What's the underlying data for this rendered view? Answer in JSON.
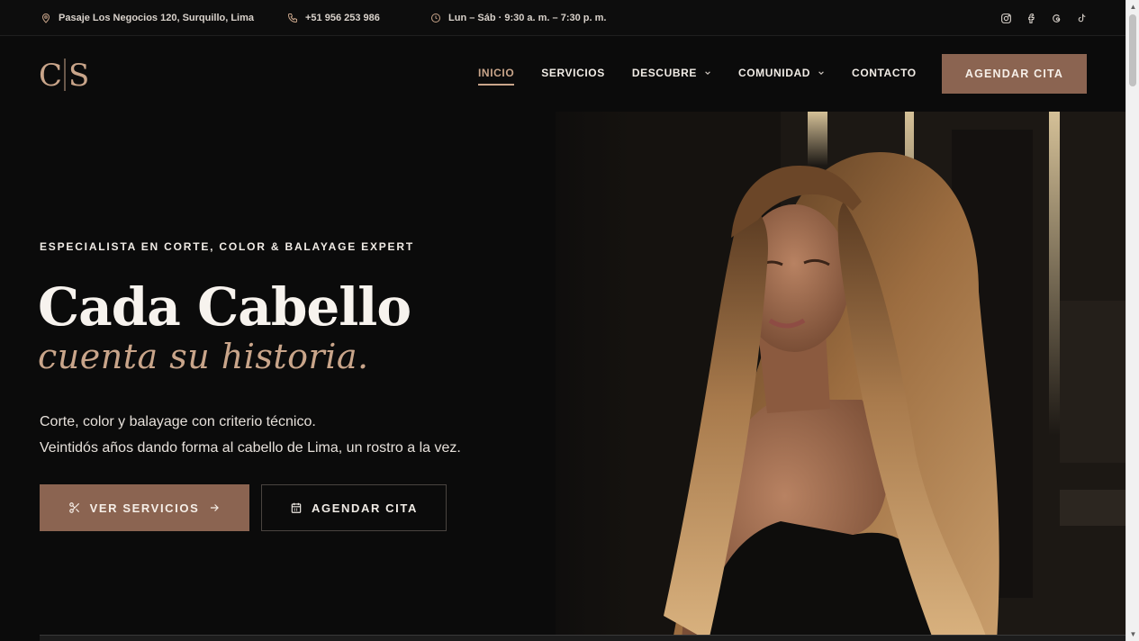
{
  "topbar": {
    "address": "Pasaje Los Negocios 120, Surquillo, Lima",
    "phone": "+51 956 253 986",
    "hours": "Lun – Sáb · 9:30 a. m. – 7:30 p. m.",
    "social_icons": [
      "instagram-icon",
      "facebook-icon",
      "threads-icon",
      "tiktok-icon"
    ]
  },
  "header": {
    "logo_text": "CS",
    "nav": [
      {
        "label": "INICIO",
        "active": true
      },
      {
        "label": "SERVICIOS"
      },
      {
        "label": "DESCUBRE",
        "dropdown": true
      },
      {
        "label": "COMUNIDAD",
        "dropdown": true
      },
      {
        "label": "CONTACTO"
      }
    ],
    "cta_label": "AGENDAR CITA"
  },
  "hero": {
    "kicker": "ESPECIALISTA EN CORTE, COLOR & BALAYAGE EXPERT",
    "title": "Cada Cabello",
    "script": "cuenta su historia.",
    "desc_line1": "Corte, color y balayage con criterio técnico.",
    "desc_line2": "Veintidós años dando forma al cabello de Lima, un rostro a la vez.",
    "primary_button": "VER SERVICIOS",
    "secondary_button": "AGENDAR CITA"
  },
  "colors": {
    "accent": "#8b6451",
    "accent_light": "#c9a58a",
    "background": "#0b0b0b"
  }
}
